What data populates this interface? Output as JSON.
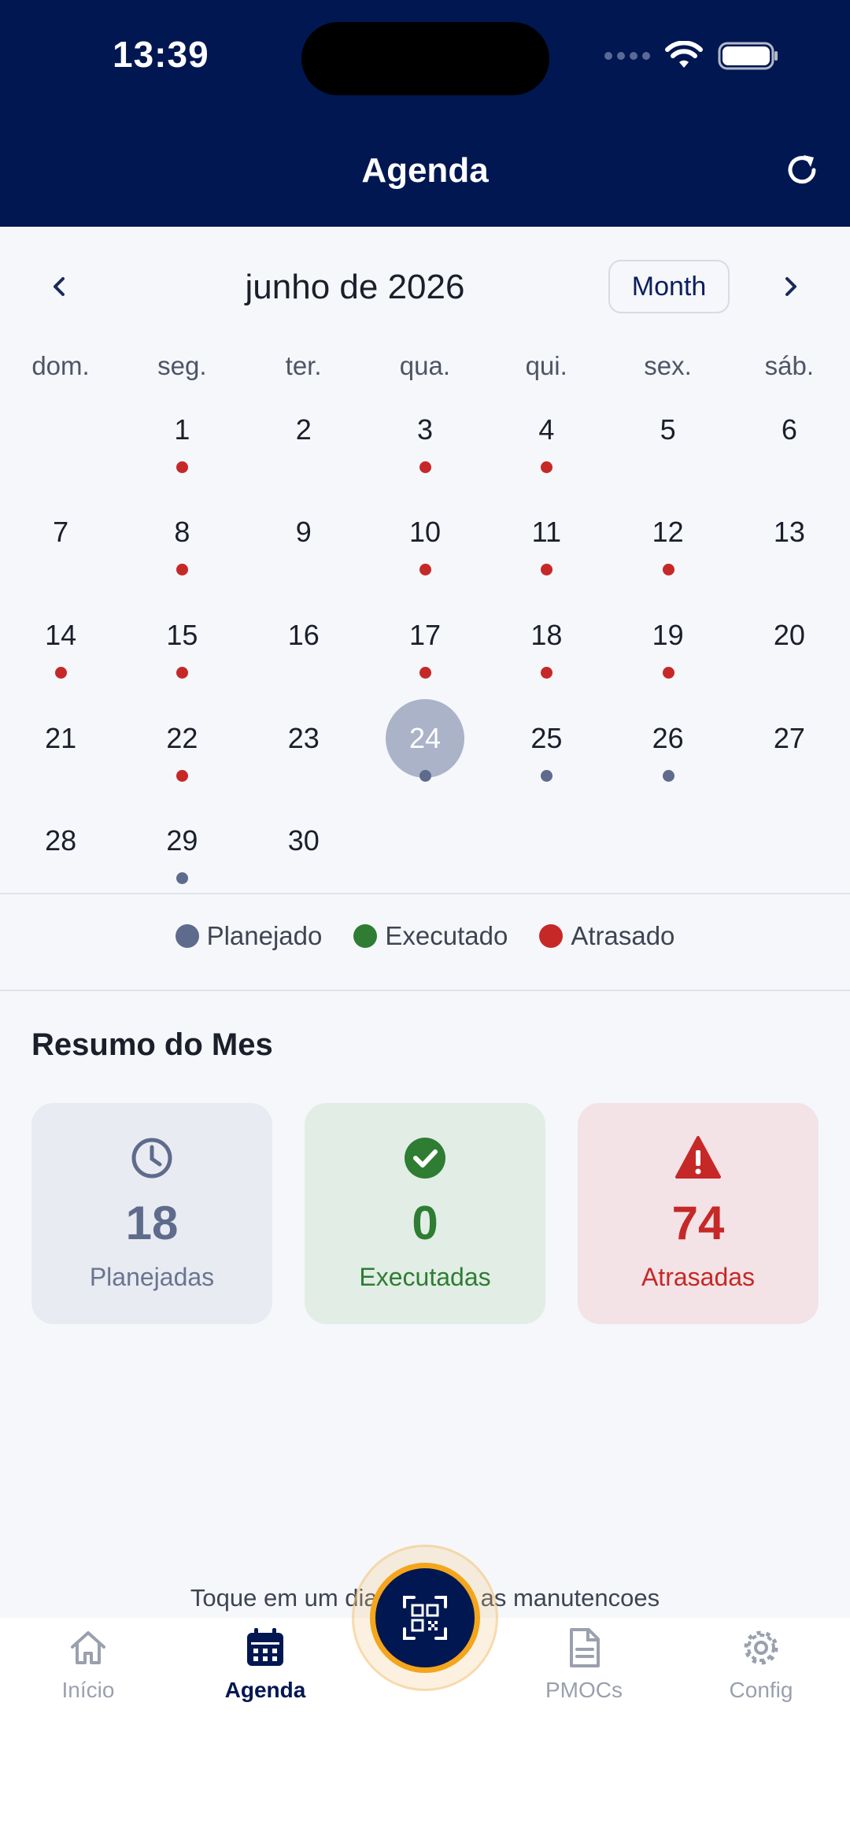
{
  "status_bar": {
    "time": "13:39"
  },
  "header": {
    "title": "Agenda",
    "refresh_icon": "refresh-icon"
  },
  "calendar": {
    "month_title": "junho de 2026",
    "view_button": "Month",
    "weekdays": [
      "dom.",
      "seg.",
      "ter.",
      "qua.",
      "qui.",
      "sex.",
      "sáb."
    ],
    "selected_day": "24",
    "weeks": [
      [
        {
          "d": ""
        },
        {
          "d": "1",
          "s": "atrasado"
        },
        {
          "d": "2"
        },
        {
          "d": "3",
          "s": "atrasado"
        },
        {
          "d": "4",
          "s": "atrasado"
        },
        {
          "d": "5"
        },
        {
          "d": "6"
        }
      ],
      [
        {
          "d": "7"
        },
        {
          "d": "8",
          "s": "atrasado"
        },
        {
          "d": "9"
        },
        {
          "d": "10",
          "s": "atrasado"
        },
        {
          "d": "11",
          "s": "atrasado"
        },
        {
          "d": "12",
          "s": "atrasado"
        },
        {
          "d": "13"
        }
      ],
      [
        {
          "d": "14",
          "s": "atrasado"
        },
        {
          "d": "15",
          "s": "atrasado"
        },
        {
          "d": "16"
        },
        {
          "d": "17",
          "s": "atrasado"
        },
        {
          "d": "18",
          "s": "atrasado"
        },
        {
          "d": "19",
          "s": "atrasado"
        },
        {
          "d": "20"
        }
      ],
      [
        {
          "d": "21"
        },
        {
          "d": "22",
          "s": "atrasado"
        },
        {
          "d": "23"
        },
        {
          "d": "24",
          "s": "planejado"
        },
        {
          "d": "25",
          "s": "planejado"
        },
        {
          "d": "26",
          "s": "planejado"
        },
        {
          "d": "27"
        }
      ],
      [
        {
          "d": "28"
        },
        {
          "d": "29",
          "s": "planejado"
        },
        {
          "d": "30"
        },
        {
          "d": ""
        },
        {
          "d": ""
        },
        {
          "d": ""
        },
        {
          "d": ""
        }
      ]
    ]
  },
  "legend": {
    "planejado": "Planejado",
    "executado": "Executado",
    "atrasado": "Atrasado"
  },
  "colors": {
    "planejado": "#5f6b8c",
    "executado": "#2e7d32",
    "atrasado": "#c62828",
    "header_bg": "#011751",
    "fab_ring": "#f4a51c"
  },
  "summary": {
    "title": "Resumo do Mes",
    "cards": [
      {
        "icon": "clock-icon",
        "value": "18",
        "label": "Planejadas"
      },
      {
        "icon": "check-circle-icon",
        "value": "0",
        "label": "Executadas"
      },
      {
        "icon": "warning-icon",
        "value": "74",
        "label": "Atrasadas"
      }
    ]
  },
  "hint": "Toque em um dia para ver as manutencoes",
  "nav": {
    "items": [
      {
        "icon": "home-icon",
        "label": "Início"
      },
      {
        "icon": "calendar-icon",
        "label": "Agenda"
      },
      {
        "icon": "document-icon",
        "label": "PMOCs"
      },
      {
        "icon": "gear-icon",
        "label": "Config"
      }
    ],
    "active": "Agenda",
    "fab_icon": "qr-code-icon"
  }
}
